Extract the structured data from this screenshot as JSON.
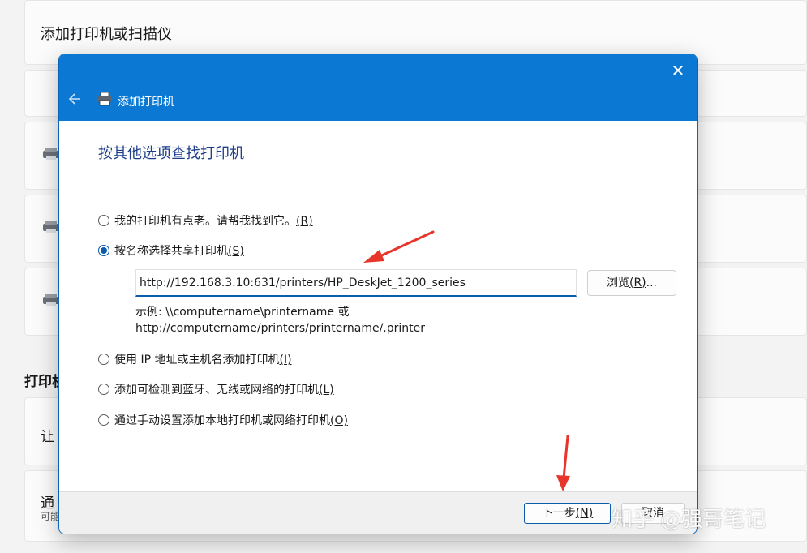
{
  "background": {
    "page_title": "添加打印机或扫描仪",
    "section_title": "打印机",
    "row_text_1": "让",
    "row_text_2": "通",
    "row_sub_2": "可能"
  },
  "dialog": {
    "title": "添加打印机",
    "heading": "按其他选项查找打印机",
    "options": [
      {
        "label": "我的打印机有点老。请帮我找到它。",
        "key": "(R)",
        "checked": false
      },
      {
        "label": "按名称选择共享打印机",
        "key": "(S)",
        "checked": true
      },
      {
        "label": "使用 IP 地址或主机名添加打印机",
        "key": "(I)",
        "checked": false
      },
      {
        "label": "添加可检测到蓝牙、无线或网络的打印机",
        "key": "(L)",
        "checked": false
      },
      {
        "label": "通过手动设置添加本地打印机或网络打印机",
        "key": "(O)",
        "checked": false
      }
    ],
    "shared_printer_url": "http://192.168.3.10:631/printers/HP_DeskJet_1200_series",
    "browse_label": "浏览",
    "browse_key": "(R)",
    "browse_suffix": "...",
    "example_line1": "示例: \\\\computername\\printername 或",
    "example_line2": "http://computername/printers/printername/.printer",
    "next_label": "下一步",
    "next_key": "(N)",
    "cancel_label": "取消"
  },
  "watermark": "知乎 @强哥笔记",
  "colors": {
    "titlebar": "#0b78d4",
    "accent": "#0b5cad",
    "heading": "#1e3f8a",
    "annotation_arrow": "#e8352b"
  }
}
